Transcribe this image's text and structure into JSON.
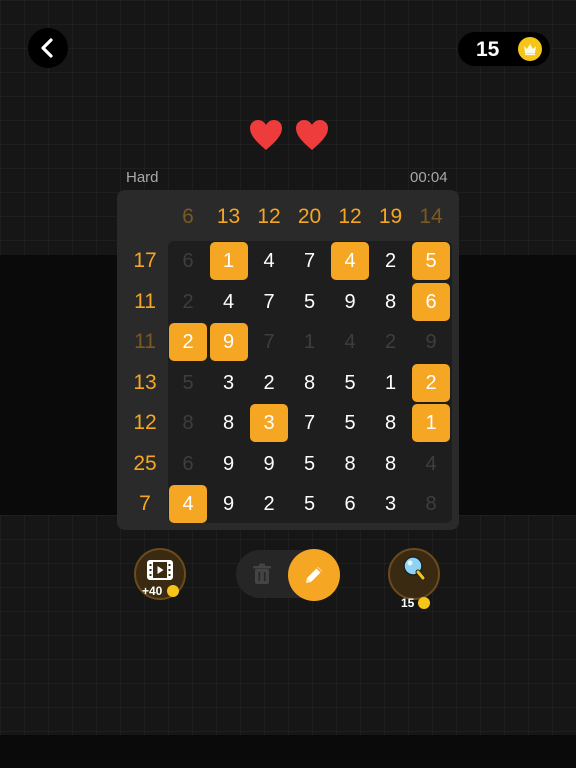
{
  "header": {
    "back_icon": "chevron-left-icon",
    "coins": "15",
    "coin_icon": "crown-coin-icon"
  },
  "lives": {
    "count": 2,
    "icon": "heart-icon",
    "color": "#ee3b3b"
  },
  "game": {
    "difficulty": "Hard",
    "timer": "00:04",
    "accent_color": "#f5a623",
    "column_sums": [
      {
        "value": "6",
        "done": true
      },
      {
        "value": "13",
        "done": false
      },
      {
        "value": "12",
        "done": false
      },
      {
        "value": "20",
        "done": false
      },
      {
        "value": "12",
        "done": false
      },
      {
        "value": "19",
        "done": false
      },
      {
        "value": "14",
        "done": true
      }
    ],
    "row_sums": [
      {
        "value": "17",
        "done": false
      },
      {
        "value": "11",
        "done": false
      },
      {
        "value": "11",
        "done": true
      },
      {
        "value": "13",
        "done": false
      },
      {
        "value": "12",
        "done": false
      },
      {
        "value": "25",
        "done": false
      },
      {
        "value": "7",
        "done": false
      }
    ],
    "grid": [
      [
        {
          "v": "6",
          "s": "removed"
        },
        {
          "v": "1",
          "s": "circled"
        },
        {
          "v": "4",
          "s": "normal"
        },
        {
          "v": "7",
          "s": "normal"
        },
        {
          "v": "4",
          "s": "circled"
        },
        {
          "v": "2",
          "s": "normal"
        },
        {
          "v": "5",
          "s": "circled"
        }
      ],
      [
        {
          "v": "2",
          "s": "removed"
        },
        {
          "v": "4",
          "s": "normal"
        },
        {
          "v": "7",
          "s": "normal"
        },
        {
          "v": "5",
          "s": "normal"
        },
        {
          "v": "9",
          "s": "normal"
        },
        {
          "v": "8",
          "s": "normal"
        },
        {
          "v": "6",
          "s": "circled"
        }
      ],
      [
        {
          "v": "2",
          "s": "circled"
        },
        {
          "v": "9",
          "s": "circled"
        },
        {
          "v": "7",
          "s": "removed"
        },
        {
          "v": "1",
          "s": "removed"
        },
        {
          "v": "4",
          "s": "removed"
        },
        {
          "v": "2",
          "s": "removed"
        },
        {
          "v": "9",
          "s": "removed"
        }
      ],
      [
        {
          "v": "5",
          "s": "removed"
        },
        {
          "v": "3",
          "s": "normal"
        },
        {
          "v": "2",
          "s": "normal"
        },
        {
          "v": "8",
          "s": "normal"
        },
        {
          "v": "5",
          "s": "normal"
        },
        {
          "v": "1",
          "s": "normal"
        },
        {
          "v": "2",
          "s": "circled"
        }
      ],
      [
        {
          "v": "8",
          "s": "removed"
        },
        {
          "v": "8",
          "s": "normal"
        },
        {
          "v": "3",
          "s": "circled"
        },
        {
          "v": "7",
          "s": "normal"
        },
        {
          "v": "5",
          "s": "normal"
        },
        {
          "v": "8",
          "s": "normal"
        },
        {
          "v": "1",
          "s": "circled"
        }
      ],
      [
        {
          "v": "6",
          "s": "removed"
        },
        {
          "v": "9",
          "s": "normal"
        },
        {
          "v": "9",
          "s": "normal"
        },
        {
          "v": "5",
          "s": "normal"
        },
        {
          "v": "8",
          "s": "normal"
        },
        {
          "v": "8",
          "s": "normal"
        },
        {
          "v": "4",
          "s": "removed"
        }
      ],
      [
        {
          "v": "4",
          "s": "circled"
        },
        {
          "v": "9",
          "s": "normal"
        },
        {
          "v": "2",
          "s": "normal"
        },
        {
          "v": "5",
          "s": "normal"
        },
        {
          "v": "6",
          "s": "normal"
        },
        {
          "v": "3",
          "s": "normal"
        },
        {
          "v": "8",
          "s": "removed"
        }
      ]
    ]
  },
  "tools": {
    "video": {
      "icon": "film-play-icon",
      "label": "+40"
    },
    "erase": {
      "icon": "trash-icon"
    },
    "pencil": {
      "icon": "pencil-icon"
    },
    "hint": {
      "icon": "lightbulb-icon",
      "label": "15"
    }
  }
}
